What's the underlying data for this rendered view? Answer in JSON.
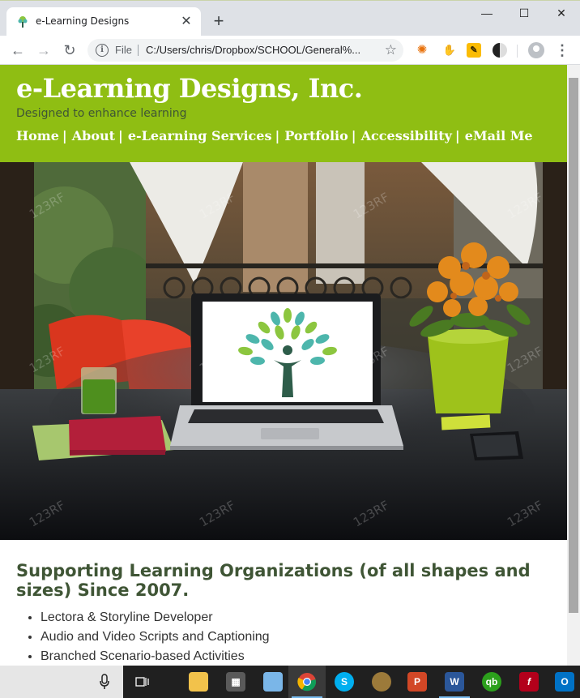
{
  "browser": {
    "tab_title": "e-Learning Designs",
    "tab_close": "✕",
    "new_tab": "+",
    "window_minimize": "—",
    "window_maximize": "☐",
    "window_close": "✕",
    "url_scheme": "File",
    "url": "C:/Users/chris/Dropbox/SCHOOL/General%...",
    "back": "←",
    "forward": "→",
    "reload": "↻",
    "bookmark_star": "☆",
    "menu": "⋮"
  },
  "site": {
    "title": "e-Learning Designs, Inc.",
    "tagline": "Designed to enhance learning",
    "nav": [
      {
        "label": "Home"
      },
      {
        "label": "About"
      },
      {
        "label": "e-Learning Services"
      },
      {
        "label": "Portfolio"
      },
      {
        "label": "Accessibility"
      },
      {
        "label": "eMail Me"
      }
    ],
    "nav_separator": "|"
  },
  "main": {
    "heading": "Supporting Learning Organizations (of all shapes and sizes) Since 2007.",
    "services": [
      "Lectora & Storyline Developer",
      "Audio and Video Scripts and Captioning",
      "Branched Scenario-based Activities"
    ]
  },
  "colors": {
    "header_bg": "#8fbe13",
    "heading_text": "#3f5535",
    "tagline_text": "#3f5535"
  }
}
